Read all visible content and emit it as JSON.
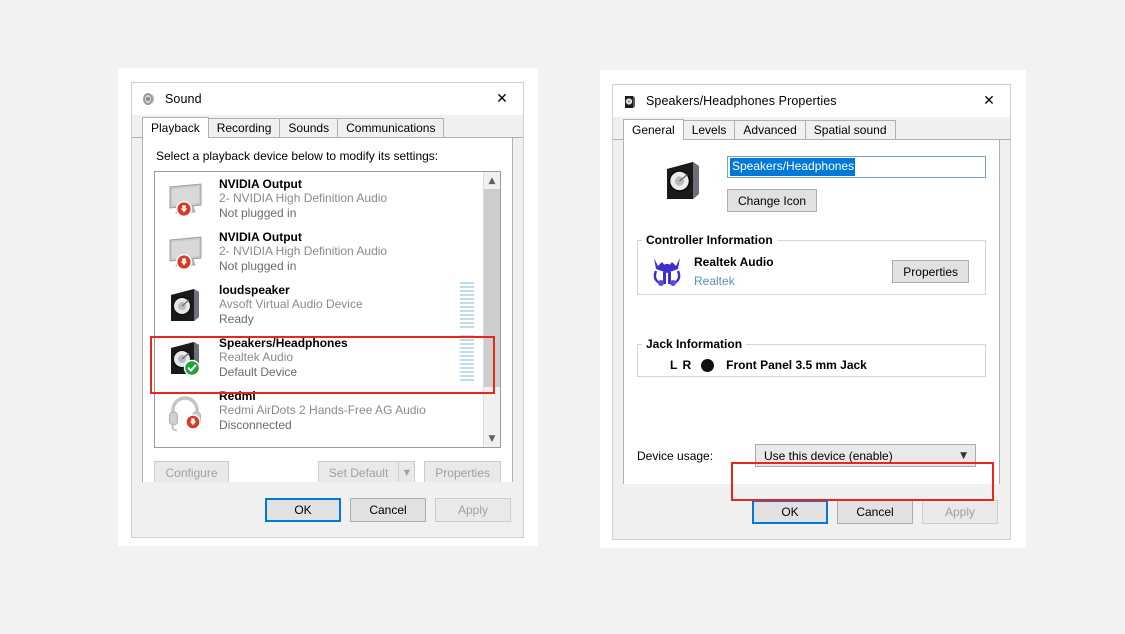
{
  "sound_dialog": {
    "title": "Sound",
    "title_icon": "speaker-icon",
    "close_label": "✕",
    "tabs": [
      {
        "label": "Playback",
        "active": true
      },
      {
        "label": "Recording",
        "active": false
      },
      {
        "label": "Sounds",
        "active": false
      },
      {
        "label": "Communications",
        "active": false
      }
    ],
    "hint": "Select a playback device below to modify its settings:",
    "devices": [
      {
        "name": "NVIDIA Output",
        "sub": "2- NVIDIA High Definition Audio",
        "state": "Not plugged in",
        "icon": "monitor-icon",
        "badge": "red-down-arrow",
        "meter": 0
      },
      {
        "name": "NVIDIA Output",
        "sub": "2- NVIDIA High Definition Audio",
        "state": "Not plugged in",
        "icon": "monitor-icon",
        "badge": "red-down-arrow",
        "meter": 0
      },
      {
        "name": "loudspeaker",
        "sub": "Avsoft Virtual Audio Device",
        "state": "Ready",
        "icon": "speaker-box-icon",
        "badge": "none",
        "meter": 12
      },
      {
        "name": "Speakers/Headphones",
        "sub": "Realtek Audio",
        "state": "Default Device",
        "icon": "speaker-box-icon",
        "badge": "green-check",
        "meter": 12
      },
      {
        "name": "Redmi",
        "sub": "Redmi AirDots 2 Hands-Free AG Audio",
        "state": "Disconnected",
        "icon": "headset-icon",
        "badge": "red-down-arrow",
        "meter": 0
      }
    ],
    "mid_buttons": {
      "configure": "Configure",
      "set_default": "Set Default",
      "properties": "Properties"
    },
    "footer": {
      "ok": "OK",
      "cancel": "Cancel",
      "apply": "Apply"
    }
  },
  "props_dialog": {
    "title": "Speakers/Headphones Properties",
    "title_icon": "speaker-properties-icon",
    "close_label": "✕",
    "tabs": [
      {
        "label": "General",
        "active": true
      },
      {
        "label": "Levels",
        "active": false
      },
      {
        "label": "Advanced",
        "active": false
      },
      {
        "label": "Spatial sound",
        "active": false
      }
    ],
    "device_icon": "speaker-box-icon",
    "name_field": {
      "value": "Speakers/Headphones",
      "selected": true
    },
    "change_icon_button": "Change Icon",
    "controller": {
      "legend": "Controller Information",
      "logo": "realtek-logo-icon",
      "name": "Realtek Audio",
      "vendor": "Realtek",
      "properties_button": "Properties"
    },
    "jack": {
      "legend": "Jack Information",
      "channels": "L R",
      "dot": "jack-dot-icon",
      "text": "Front Panel 3.5 mm Jack"
    },
    "device_usage": {
      "label": "Device usage:",
      "value": "Use this device (enable)",
      "chevron": "chevron-down-icon"
    },
    "footer": {
      "ok": "OK",
      "cancel": "Cancel",
      "apply": "Apply"
    }
  },
  "annotations": {
    "selected_device_highlight_color": "#e8271b",
    "device_usage_highlight_color": "#e8271b"
  }
}
